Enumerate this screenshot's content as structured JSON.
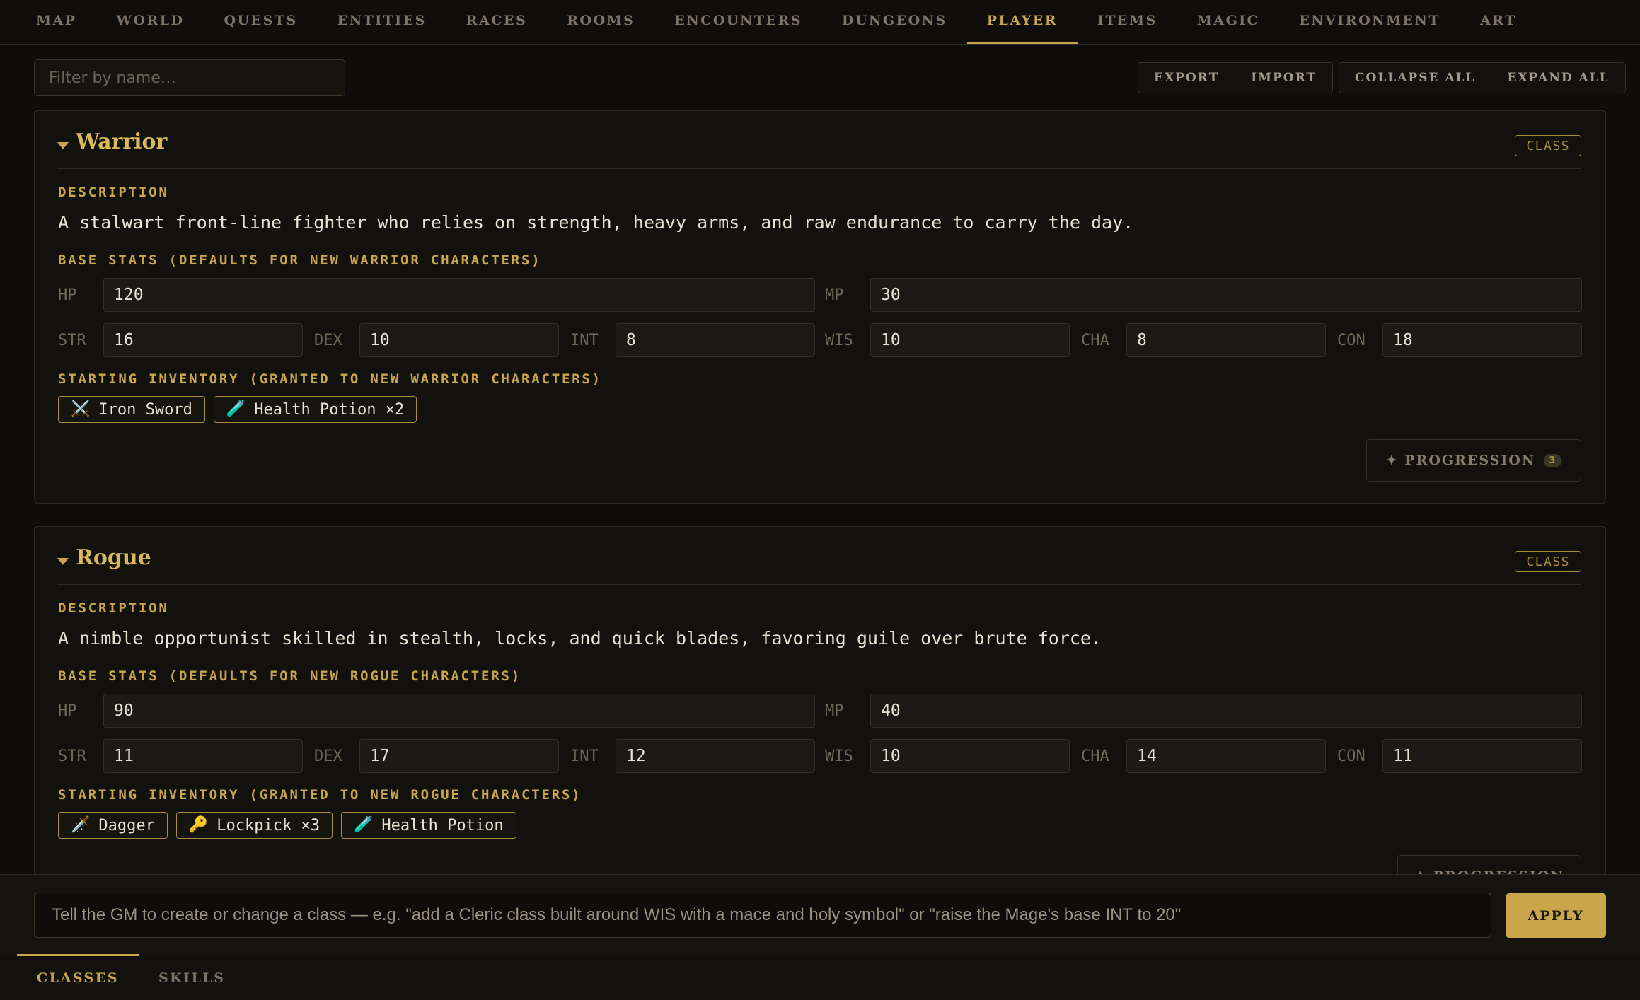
{
  "nav": {
    "tabs": [
      "MAP",
      "WORLD",
      "QUESTS",
      "ENTITIES",
      "RACES",
      "ROOMS",
      "ENCOUNTERS",
      "DUNGEONS",
      "PLAYER",
      "ITEMS",
      "MAGIC",
      "ENVIRONMENT",
      "ART"
    ],
    "active": "PLAYER"
  },
  "toolbar": {
    "filter_placeholder": "Filter by name…",
    "export_label": "EXPORT",
    "import_label": "IMPORT",
    "collapse_label": "COLLAPSE ALL",
    "expand_label": "EXPAND ALL"
  },
  "classes": [
    {
      "name": "Warrior",
      "badge": "CLASS",
      "description_label": "DESCRIPTION",
      "description": "A stalwart front-line fighter who relies on strength, heavy arms, and raw endurance to carry the day.",
      "stats_label": "BASE STATS (DEFAULTS FOR NEW WARRIOR CHARACTERS)",
      "stats": {
        "HP": "120",
        "MP": "30",
        "STR": "16",
        "DEX": "10",
        "INT": "8",
        "WIS": "10",
        "CHA": "8",
        "CON": "18"
      },
      "inventory_label": "STARTING INVENTORY (GRANTED TO NEW WARRIOR CHARACTERS)",
      "inventory": [
        {
          "icon": "⚔️",
          "icon_name": "crossed-swords-icon",
          "label": "Iron Sword"
        },
        {
          "icon": "🧪",
          "icon_name": "potion-icon",
          "label": "Health Potion ×2"
        }
      ],
      "progression_label": "✦ PROGRESSION",
      "progression_count": "3"
    },
    {
      "name": "Rogue",
      "badge": "CLASS",
      "description_label": "DESCRIPTION",
      "description": "A nimble opportunist skilled in stealth, locks, and quick blades, favoring guile over brute force.",
      "stats_label": "BASE STATS (DEFAULTS FOR NEW ROGUE CHARACTERS)",
      "stats": {
        "HP": "90",
        "MP": "40",
        "STR": "11",
        "DEX": "17",
        "INT": "12",
        "WIS": "10",
        "CHA": "14",
        "CON": "11"
      },
      "inventory_label": "STARTING INVENTORY (GRANTED TO NEW ROGUE CHARACTERS)",
      "inventory": [
        {
          "icon": "🗡️",
          "icon_name": "dagger-icon",
          "label": "Dagger"
        },
        {
          "icon": "🔑",
          "icon_name": "key-icon",
          "label": "Lockpick ×3"
        },
        {
          "icon": "🧪",
          "icon_name": "potion-icon",
          "label": "Health Potion"
        }
      ],
      "progression_label": "✦ PROGRESSION"
    }
  ],
  "command": {
    "placeholder": "Tell the GM to create or change a class — e.g. \"add a Cleric class built around WIS with a mace and holy symbol\" or \"raise the Mage's base INT to 20\"",
    "apply_label": "APPLY"
  },
  "bottom_tabs": {
    "tabs": [
      "CLASSES",
      "SKILLS"
    ],
    "active": "CLASSES"
  },
  "colors": {
    "accent": "#c9a64a",
    "background": "#0e0d0b",
    "panel": "#12110d",
    "text": "#e8e2d2"
  }
}
